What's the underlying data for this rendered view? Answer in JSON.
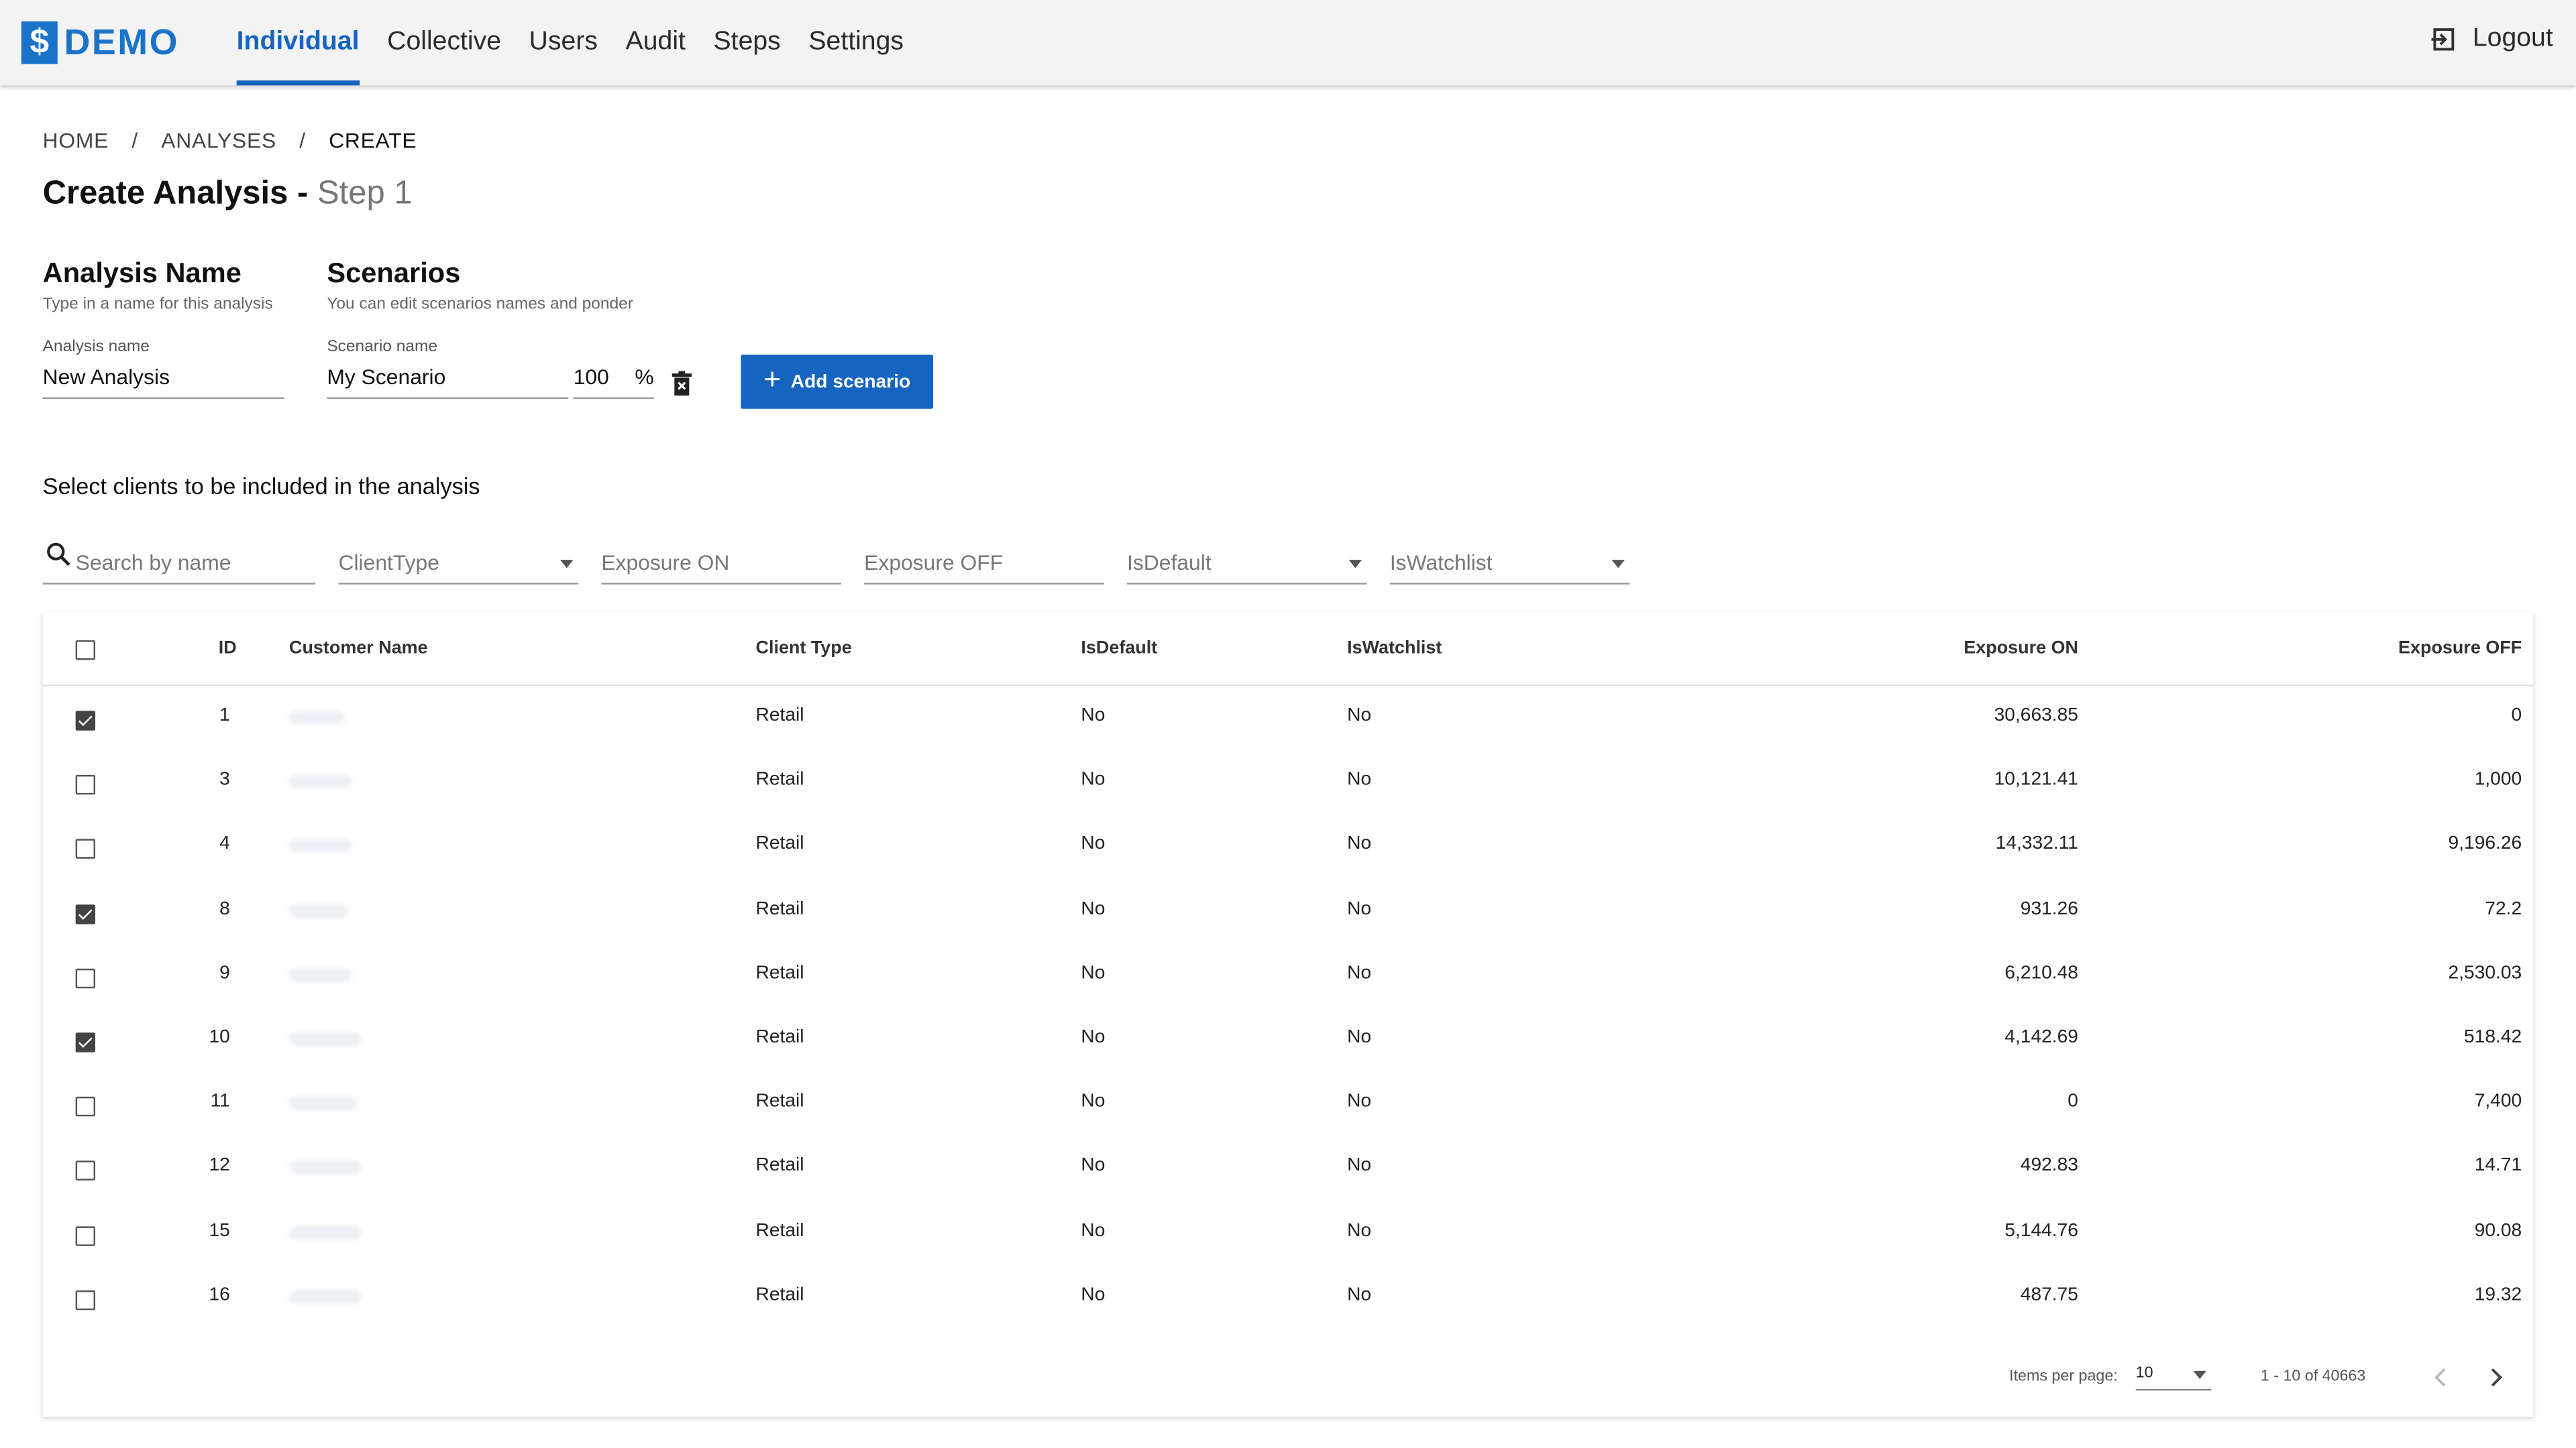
{
  "header": {
    "logo_symbol": "$",
    "logo_text": "DEMO",
    "brand_color": "#1a73c8",
    "nav": [
      {
        "label": "Individual",
        "active": true
      },
      {
        "label": "Collective",
        "active": false
      },
      {
        "label": "Users",
        "active": false
      },
      {
        "label": "Audit",
        "active": false
      },
      {
        "label": "Steps",
        "active": false
      },
      {
        "label": "Settings",
        "active": false
      }
    ],
    "logout_label": "Logout",
    "logout_icon": "logout-icon"
  },
  "breadcrumb": {
    "items": [
      "HOME",
      "ANALYSES",
      "CREATE"
    ],
    "separator": "/"
  },
  "page": {
    "title": "Create Analysis -",
    "step": "Step 1"
  },
  "analysis": {
    "title": "Analysis Name",
    "subtitle": "Type in a name for this analysis",
    "field_label": "Analysis name",
    "value": "New Analysis"
  },
  "scenarios": {
    "title": "Scenarios",
    "subtitle": "You can edit scenarios names and ponder",
    "field_label": "Scenario name",
    "name_value": "My Scenario",
    "ponder_value": "100",
    "percent": "%",
    "delete_icon": "trash-icon",
    "add_button": "Add scenario"
  },
  "clients": {
    "title": "Select clients to be included in the analysis",
    "filters": {
      "search_placeholder": "Search by name",
      "client_type": "ClientType",
      "exposure_on": "Exposure ON",
      "exposure_off": "Exposure OFF",
      "is_default": "IsDefault",
      "is_watchlist": "IsWatchlist"
    },
    "columns": {
      "id": "ID",
      "name": "Customer Name",
      "client_type": "Client Type",
      "is_default": "IsDefault",
      "is_watchlist": "IsWatchlist",
      "exposure_on": "Exposure ON",
      "exposure_off": "Exposure OFF"
    },
    "rows": [
      {
        "checked": true,
        "id": "1",
        "type": "Retail",
        "is_default": "No",
        "is_watchlist": "No",
        "exposure_on": "30,663.85",
        "exposure_off": "0"
      },
      {
        "checked": false,
        "id": "3",
        "type": "Retail",
        "is_default": "No",
        "is_watchlist": "No",
        "exposure_on": "10,121.41",
        "exposure_off": "1,000"
      },
      {
        "checked": false,
        "id": "4",
        "type": "Retail",
        "is_default": "No",
        "is_watchlist": "No",
        "exposure_on": "14,332.11",
        "exposure_off": "9,196.26"
      },
      {
        "checked": true,
        "id": "8",
        "type": "Retail",
        "is_default": "No",
        "is_watchlist": "No",
        "exposure_on": "931.26",
        "exposure_off": "72.2"
      },
      {
        "checked": false,
        "id": "9",
        "type": "Retail",
        "is_default": "No",
        "is_watchlist": "No",
        "exposure_on": "6,210.48",
        "exposure_off": "2,530.03"
      },
      {
        "checked": true,
        "id": "10",
        "type": "Retail",
        "is_default": "No",
        "is_watchlist": "No",
        "exposure_on": "4,142.69",
        "exposure_off": "518.42"
      },
      {
        "checked": false,
        "id": "11",
        "type": "Retail",
        "is_default": "No",
        "is_watchlist": "No",
        "exposure_on": "0",
        "exposure_off": "7,400"
      },
      {
        "checked": false,
        "id": "12",
        "type": "Retail",
        "is_default": "No",
        "is_watchlist": "No",
        "exposure_on": "492.83",
        "exposure_off": "14.71"
      },
      {
        "checked": false,
        "id": "15",
        "type": "Retail",
        "is_default": "No",
        "is_watchlist": "No",
        "exposure_on": "5,144.76",
        "exposure_off": "90.08"
      },
      {
        "checked": false,
        "id": "16",
        "type": "Retail",
        "is_default": "No",
        "is_watchlist": "No",
        "exposure_on": "487.75",
        "exposure_off": "19.32"
      }
    ],
    "pagination": {
      "items_per_page_label": "Items per page:",
      "items_per_page": "10",
      "range": "1 - 10 of 40663"
    }
  }
}
